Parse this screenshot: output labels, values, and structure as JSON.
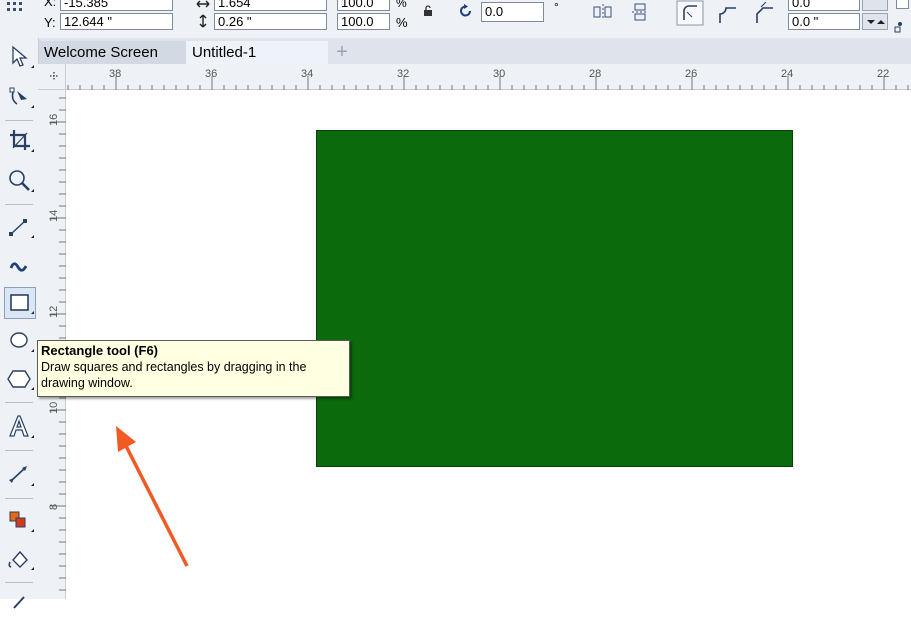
{
  "property_bar": {
    "x_label": "X:",
    "x_value": "-15.385",
    "y_label": "Y:",
    "y_value": "12.644 \"",
    "width_value": "1.654",
    "height_value": "0.26 \"",
    "scale_x_value": "100.0",
    "scale_y_value": "100.0",
    "percent_symbol": "%",
    "rotation_value": "0.0",
    "degree_symbol": "°",
    "corner_radius_top": "0.0",
    "corner_radius_bottom": "0.0 \""
  },
  "tabs": [
    {
      "label": "Welcome Screen"
    },
    {
      "label": "Untitled-1"
    }
  ],
  "add_tab_symbol": "+",
  "ruler": {
    "horizontal": [
      "38",
      "36",
      "34",
      "32",
      "30",
      "28",
      "26",
      "24",
      "22"
    ],
    "vertical": [
      "16",
      "14",
      "12",
      "10",
      "8"
    ]
  },
  "tooltip": {
    "title": "Rectangle tool (F6)",
    "line1": "Draw squares and rectangles by dragging in the",
    "line2": "drawing window."
  },
  "colors": {
    "rectangle_fill": "#0b6a0b",
    "arrow": "#f15a22",
    "tooltip_bg": "#ffffe1"
  }
}
